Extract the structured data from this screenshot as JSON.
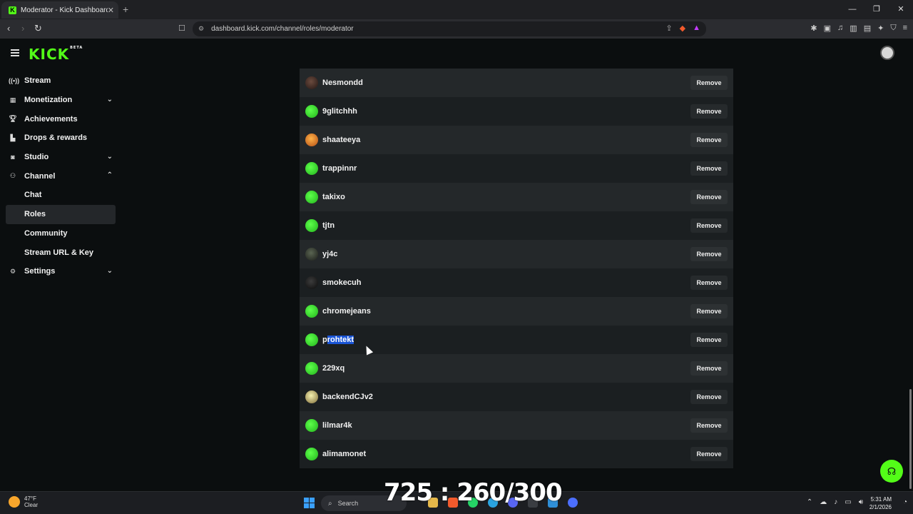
{
  "browser": {
    "tab_title": "Moderator - Kick Dashboard",
    "url": "dashboard.kick.com/channel/roles/moderator"
  },
  "header": {
    "logo": "KICK",
    "logo_badge": "BETA"
  },
  "sidebar": {
    "items": [
      {
        "label": "Stream",
        "icon": "broadcast-icon"
      },
      {
        "label": "Monetization",
        "icon": "chart-icon",
        "expandable": true
      },
      {
        "label": "Achievements",
        "icon": "trophy-icon"
      },
      {
        "label": "Drops & rewards",
        "icon": "gift-icon"
      },
      {
        "label": "Studio",
        "icon": "studio-icon",
        "expandable": true
      },
      {
        "label": "Channel",
        "icon": "channel-icon",
        "expanded": true
      },
      {
        "label": "Settings",
        "icon": "gear-icon",
        "expandable": true
      }
    ],
    "channel_subitems": [
      "Chat",
      "Roles",
      "Community",
      "Stream URL & Key"
    ]
  },
  "moderators": [
    {
      "name": "Nesmondd",
      "avatar": "dark"
    },
    {
      "name": "9glitchhh",
      "avatar": "green"
    },
    {
      "name": "shaateeya",
      "avatar": "orange"
    },
    {
      "name": "trappinnr",
      "avatar": "green"
    },
    {
      "name": "takixo",
      "avatar": "green"
    },
    {
      "name": "tjtn",
      "avatar": "green"
    },
    {
      "name": "yj4c",
      "avatar": "grey"
    },
    {
      "name": "smokecuh",
      "avatar": "black"
    },
    {
      "name": "chromejeans",
      "avatar": "green"
    },
    {
      "name": "prohtekt",
      "avatar": "green",
      "selected_prefix": "p",
      "selected_text": "rohtekt"
    },
    {
      "name": "229xq",
      "avatar": "green"
    },
    {
      "name": "backendCJv2",
      "avatar": "yellow"
    },
    {
      "name": "lilmar4k",
      "avatar": "green"
    },
    {
      "name": "alimamonet",
      "avatar": "green"
    }
  ],
  "remove_label": "Remove",
  "overlay_counter": "725 : 260/300",
  "taskbar": {
    "weather_temp": "47°F",
    "weather_desc": "Clear",
    "search_label": "Search",
    "time": "5:31 AM",
    "date": "2/1/2026"
  },
  "colors": {
    "accent": "#53fc18",
    "row_odd": "#24282a",
    "row_even": "#1b1f21",
    "selection": "#1a55d6"
  }
}
